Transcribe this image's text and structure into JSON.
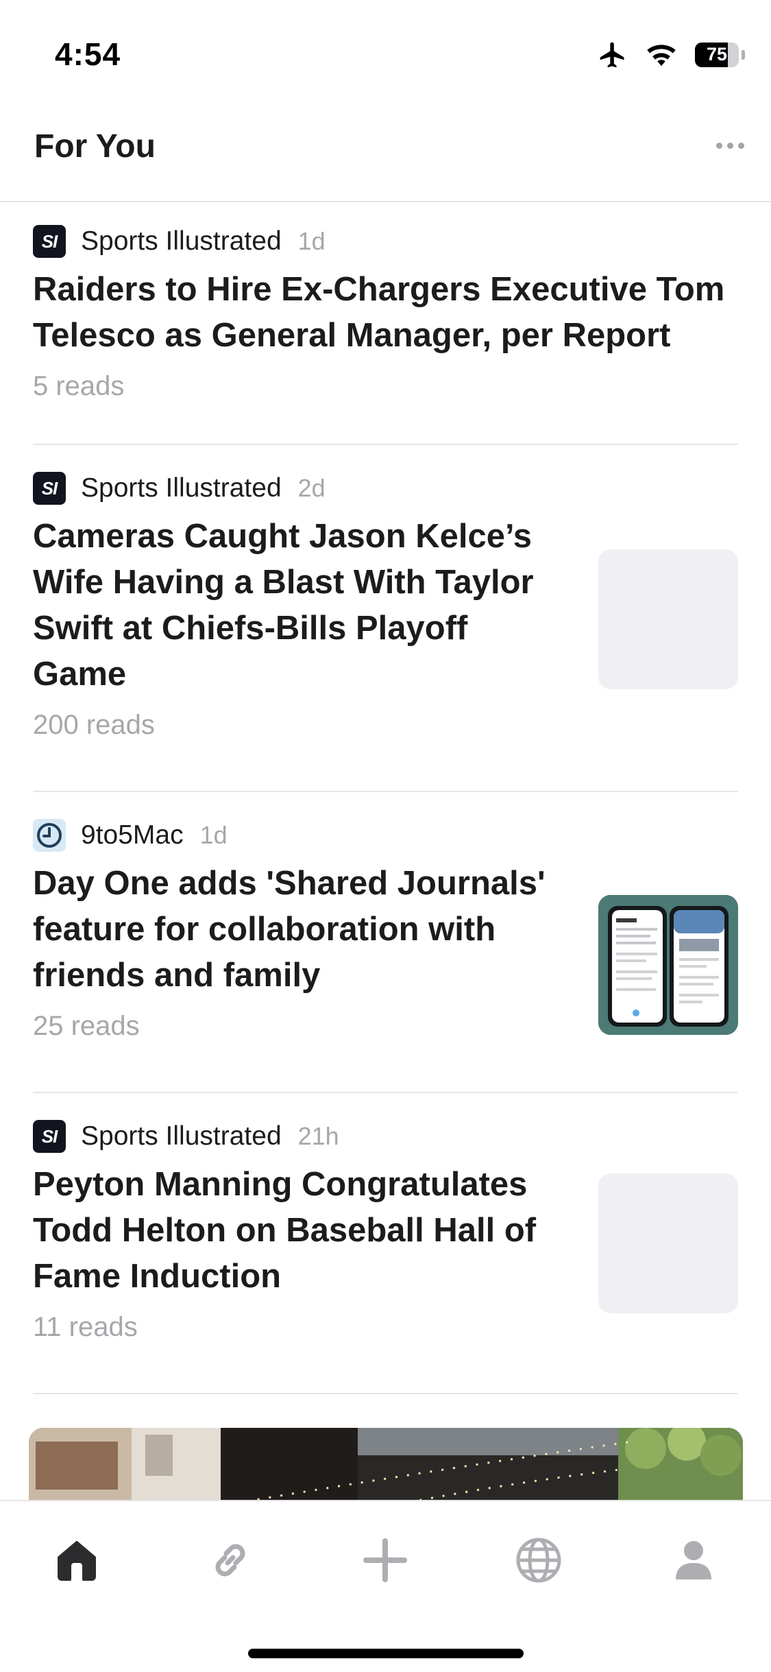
{
  "status_bar": {
    "time": "4:54",
    "battery": "75",
    "battery_level": 0.75
  },
  "header": {
    "title": "For You"
  },
  "articles": [
    {
      "source": "Sports Illustrated",
      "age": "1d",
      "title": "Raiders to Hire Ex-Chargers Executive Tom Telesco as General Manager, per Report",
      "reads": "5 reads",
      "logo": "SI"
    },
    {
      "source": "Sports Illustrated",
      "age": "2d",
      "title": "Cameras Caught Jason Kelce’s Wife Having a Blast With Taylor Swift at Chiefs-Bills Playoff Game",
      "reads": "200 reads",
      "logo": "SI"
    },
    {
      "source": "9to5Mac",
      "age": "1d",
      "title": "Day One adds 'Shared Journals' feature for collaboration with friends and family",
      "reads": "25 reads"
    },
    {
      "source": "Sports Illustrated",
      "age": "21h",
      "title": "Peyton Manning Congratulates Todd Helton on Baseball Hall of Fame Induction",
      "reads": "11 reads",
      "logo": "SI"
    }
  ],
  "tabs": [
    {
      "icon": "home-icon",
      "active": true
    },
    {
      "icon": "link-icon"
    },
    {
      "icon": "plus-icon"
    },
    {
      "icon": "globe-icon"
    },
    {
      "icon": "profile-icon"
    }
  ],
  "colors": {
    "active_tab": "#2c2c2e",
    "inactive_tab": "#aeaeb2",
    "secondary_text": "#a7a7ab"
  }
}
